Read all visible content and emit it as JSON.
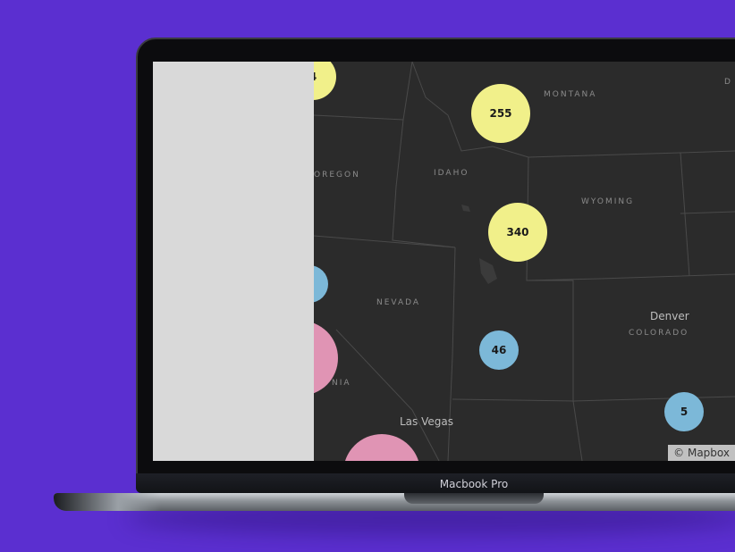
{
  "device": {
    "label": "Macbook Pro"
  },
  "colors": {
    "background": "#5b2fd0",
    "map_base": "#2b2b2b",
    "sidebar": "#d9d9d9",
    "cluster_small": "#7cb8d8",
    "cluster_medium": "#f1f08a",
    "cluster_large": "#e094b4"
  },
  "map": {
    "states": [
      "MONTANA",
      "IDAHO",
      "OREGON",
      "WYOMING",
      "NEVADA",
      "COLORADO",
      "NIA",
      "D"
    ],
    "cities": [
      "Denver",
      "Las Vegas"
    ],
    "clusters": [
      "4",
      "255",
      "340",
      "46",
      "5",
      "",
      "",
      ""
    ],
    "attribution": "© Mapbox"
  }
}
